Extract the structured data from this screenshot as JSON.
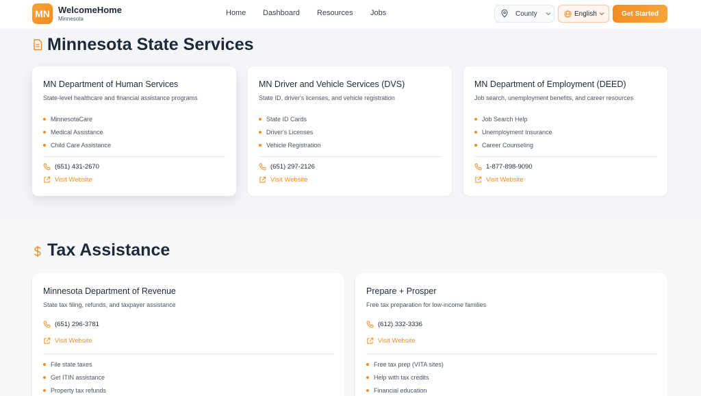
{
  "header": {
    "logo_text": "MN",
    "brand_name": "WelcomeHome",
    "brand_sub": "Minnesota",
    "nav": [
      "Home",
      "Dashboard",
      "Resources",
      "Jobs"
    ],
    "county_label": "County",
    "language_label": "English",
    "cta_label": "Get Started"
  },
  "colors": {
    "accent": "#f28c1e",
    "heading": "#1f2937",
    "muted": "#4b5563"
  },
  "state": {
    "heading": "Minnesota State Services",
    "cards": [
      {
        "title": "MN Department of Human Services",
        "desc": "State-level healthcare and financial assistance programs",
        "items": [
          "MinnesotaCare",
          "Medical Assistance",
          "Child Care Assistance"
        ],
        "phone": "(651) 431-2670",
        "link": "Visit Website"
      },
      {
        "title": "MN Driver and Vehicle Services (DVS)",
        "desc": "State ID, driver's licenses, and vehicle registration",
        "items": [
          "State ID Cards",
          "Driver's Licenses",
          "Vehicle Registration"
        ],
        "phone": "(651) 297-2126",
        "link": "Visit Website"
      },
      {
        "title": "MN Department of Employment (DEED)",
        "desc": "Job search, unemployment benefits, and career resources",
        "items": [
          "Job Search Help",
          "Unemployment Insurance",
          "Career Counseling"
        ],
        "phone": "1-877-898-9090",
        "link": "Visit Website"
      }
    ]
  },
  "tax": {
    "heading": "Tax Assistance",
    "cards": [
      {
        "title": "Minnesota Department of Revenue",
        "desc": "State tax filing, refunds, and taxpayer assistance",
        "phone": "(651) 296-3781",
        "link": "Visit Website",
        "items": [
          "File state taxes",
          "Get ITIN assistance",
          "Property tax refunds"
        ]
      },
      {
        "title": "Prepare + Prosper",
        "desc": "Free tax preparation for low-income families",
        "phone": "(612) 332-3336",
        "link": "Visit Website",
        "items": [
          "Free tax prep (VITA sites)",
          "Help with tax credits",
          "Financial education"
        ]
      }
    ]
  }
}
